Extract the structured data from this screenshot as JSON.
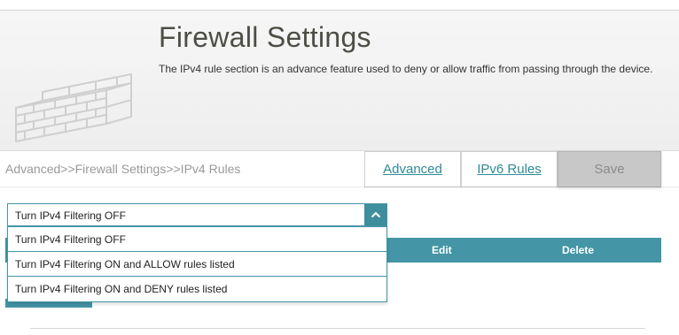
{
  "header": {
    "title": "Firewall Settings",
    "description": "The IPv4 rule section is an advance feature used to deny or allow traffic from passing through the device."
  },
  "breadcrumb": "Advanced>>Firewall Settings>>IPv4 Rules",
  "nav": {
    "advanced_label": "Advanced",
    "ipv6_label": "IPv6 Rules",
    "save_label": "Save"
  },
  "filter_select": {
    "selected": "Turn IPv4 Filtering OFF",
    "options": [
      "Turn IPv4 Filtering OFF",
      "Turn IPv4 Filtering ON and ALLOW rules listed",
      "Turn IPv4 Filtering ON and DENY rules listed"
    ]
  },
  "table": {
    "headers": {
      "edit": "Edit",
      "delete": "Delete"
    }
  },
  "icons": {
    "banner": "brick-wall-icon",
    "select_arrow": "chevron-up-icon"
  },
  "colors": {
    "accent": "#4495a5",
    "title": "#4b4e44",
    "link": "#2f8a98",
    "save_disabled": "#c8c8c8"
  }
}
